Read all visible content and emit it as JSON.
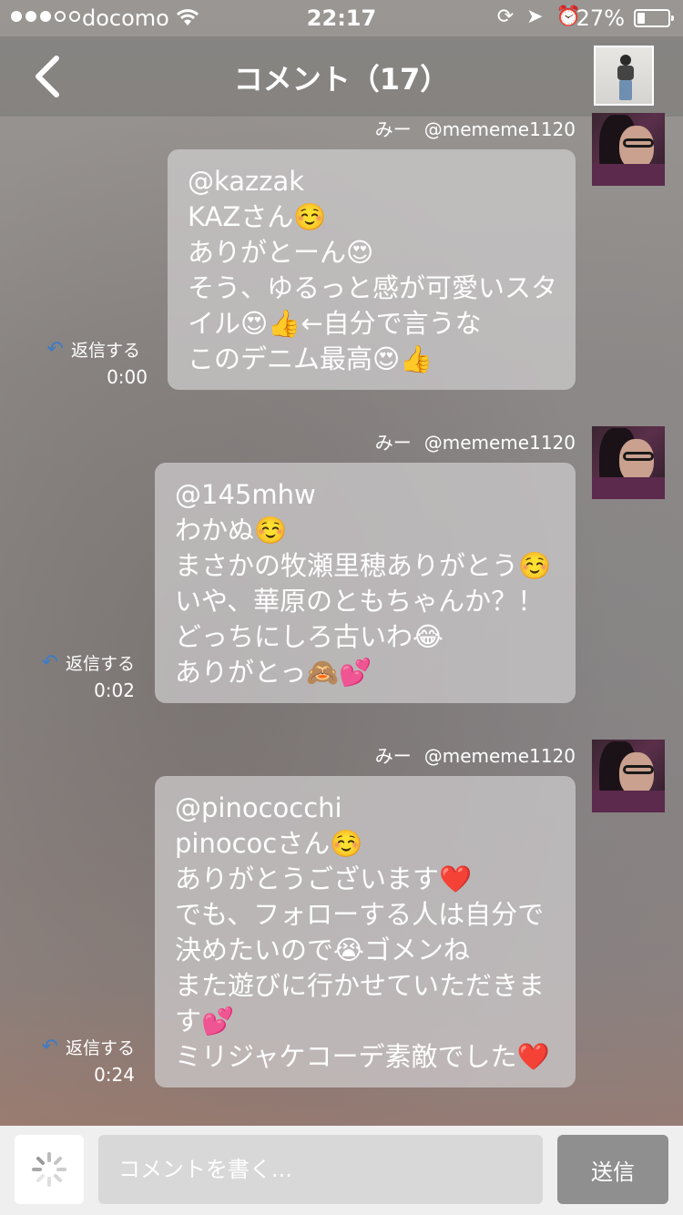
{
  "status_bar": {
    "carrier": "docomo",
    "time": "22:17",
    "battery": "27%",
    "signal_dots_filled": 3,
    "signal_dots_total": 5
  },
  "nav": {
    "title": "コメント（17）",
    "back_icon": "chevron-left-icon",
    "post_thumbnail_alt": "post-thumbnail"
  },
  "comments": [
    {
      "nickname": "みー",
      "username": "@mememe1120",
      "lines": [
        "@kazzak",
        "KAZさん☺️",
        "ありがとーん😍",
        "そう、ゆるっと感が可愛いスタ",
        "イル😍👍←自分で言うな",
        "このデニム最高😍👍"
      ],
      "reply_label": "返信する",
      "time": "0:00"
    },
    {
      "nickname": "みー",
      "username": "@mememe1120",
      "lines": [
        "@145mhw",
        "わかぬ☺️",
        "まさかの牧瀬里穂ありがとう☺️",
        "いや、華原のともちゃんか？！",
        "どっちにしろ古いわ😂",
        "ありがとっ🙈💕"
      ],
      "reply_label": "返信する",
      "time": "0:02"
    },
    {
      "nickname": "みー",
      "username": "@mememe1120",
      "lines": [
        "@pinococchi",
        "pinococさん☺️",
        "ありがとうございます❤️",
        "でも、フォローする人は自分で",
        "決めたいので😭ゴメンね",
        "また遊びに行かせていただきま",
        "す💕",
        "ミリジャケコーデ素敵でした❤️"
      ],
      "reply_label": "返信する",
      "time": "0:24"
    }
  ],
  "input_bar": {
    "placeholder": "コメントを書く...",
    "send_label": "送信"
  }
}
